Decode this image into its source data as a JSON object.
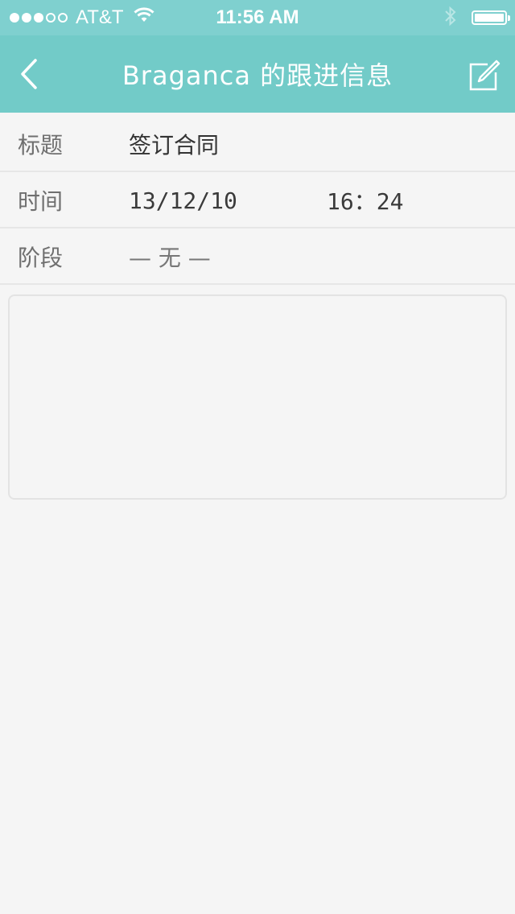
{
  "status_bar": {
    "carrier": "AT&T",
    "time": "11:56 AM",
    "signal_full": 3,
    "signal_total": 5,
    "battery_level": 1.0
  },
  "nav": {
    "title": "Braganca 的跟进信息",
    "back_icon": "chevron-left-icon",
    "edit_icon": "compose-icon"
  },
  "fields": {
    "title_label": "标题",
    "title_value": "签订合同",
    "time_label": "时间",
    "date_value": "13/12/10",
    "time_value": "16：24",
    "stage_label": "阶段",
    "stage_value": "— 无 —"
  },
  "note": {
    "text": ""
  },
  "colors": {
    "nav_bg": "#72cbc8",
    "status_bg": "#7fd0cf",
    "page_bg": "#f5f5f5"
  }
}
